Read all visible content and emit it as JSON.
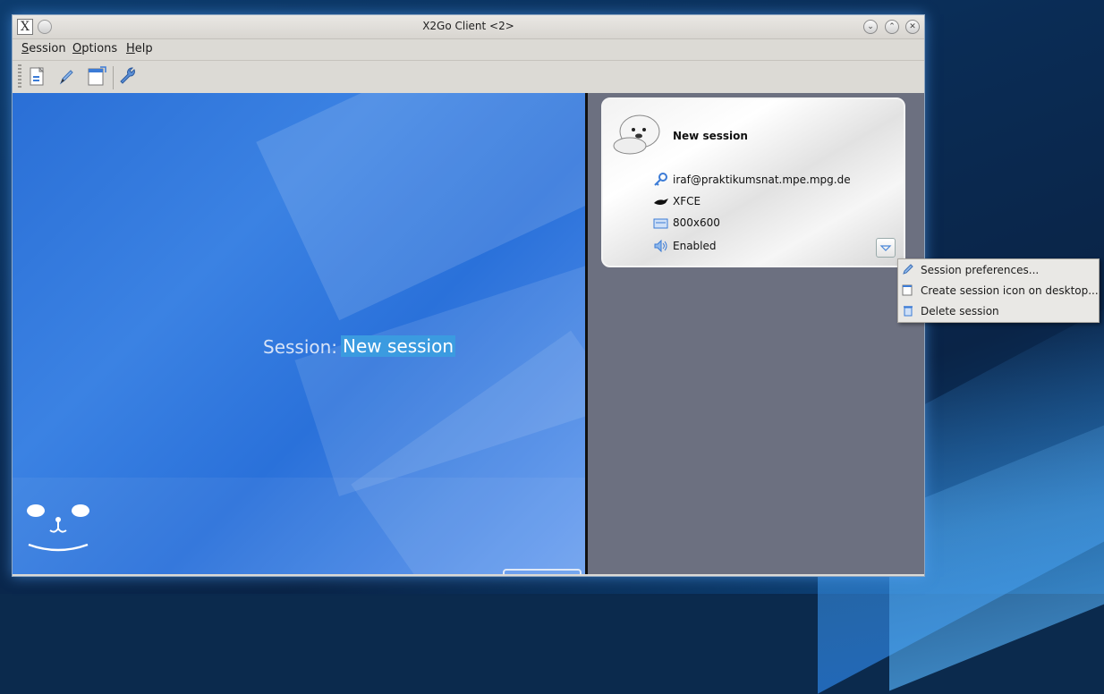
{
  "window": {
    "title": "X2Go Client <2>",
    "app_icon_glyph": "X"
  },
  "menubar": {
    "items": [
      {
        "label": "Session",
        "underline": "S",
        "rest": "ession"
      },
      {
        "label": "Options",
        "underline": "O",
        "rest": "ptions"
      },
      {
        "label": "Help",
        "underline": "H",
        "rest": "elp"
      }
    ]
  },
  "toolbar": {
    "tools": [
      "new-session-icon",
      "edit-session-icon",
      "session-desktop-icon-icon",
      "preferences-wrench-icon"
    ]
  },
  "main": {
    "session_label": "Session:",
    "session_value": "New session"
  },
  "session_card": {
    "name": "New session",
    "server": "iraf@praktikumsnat.mpe.mpg.de",
    "desktop": "XFCE",
    "geometry": "800x600",
    "sound": "Enabled"
  },
  "context_menu": {
    "items": [
      {
        "label": "Session preferences...",
        "icon": "pencil-icon"
      },
      {
        "label": "Create session icon on desktop...",
        "icon": "desktop-shortcut-icon"
      },
      {
        "label": "Delete session",
        "icon": "trash-icon"
      }
    ]
  },
  "colors": {
    "accent": "#3b9be0",
    "session_pane": "#6c7080",
    "brand_blue": "#2a6fd6"
  }
}
